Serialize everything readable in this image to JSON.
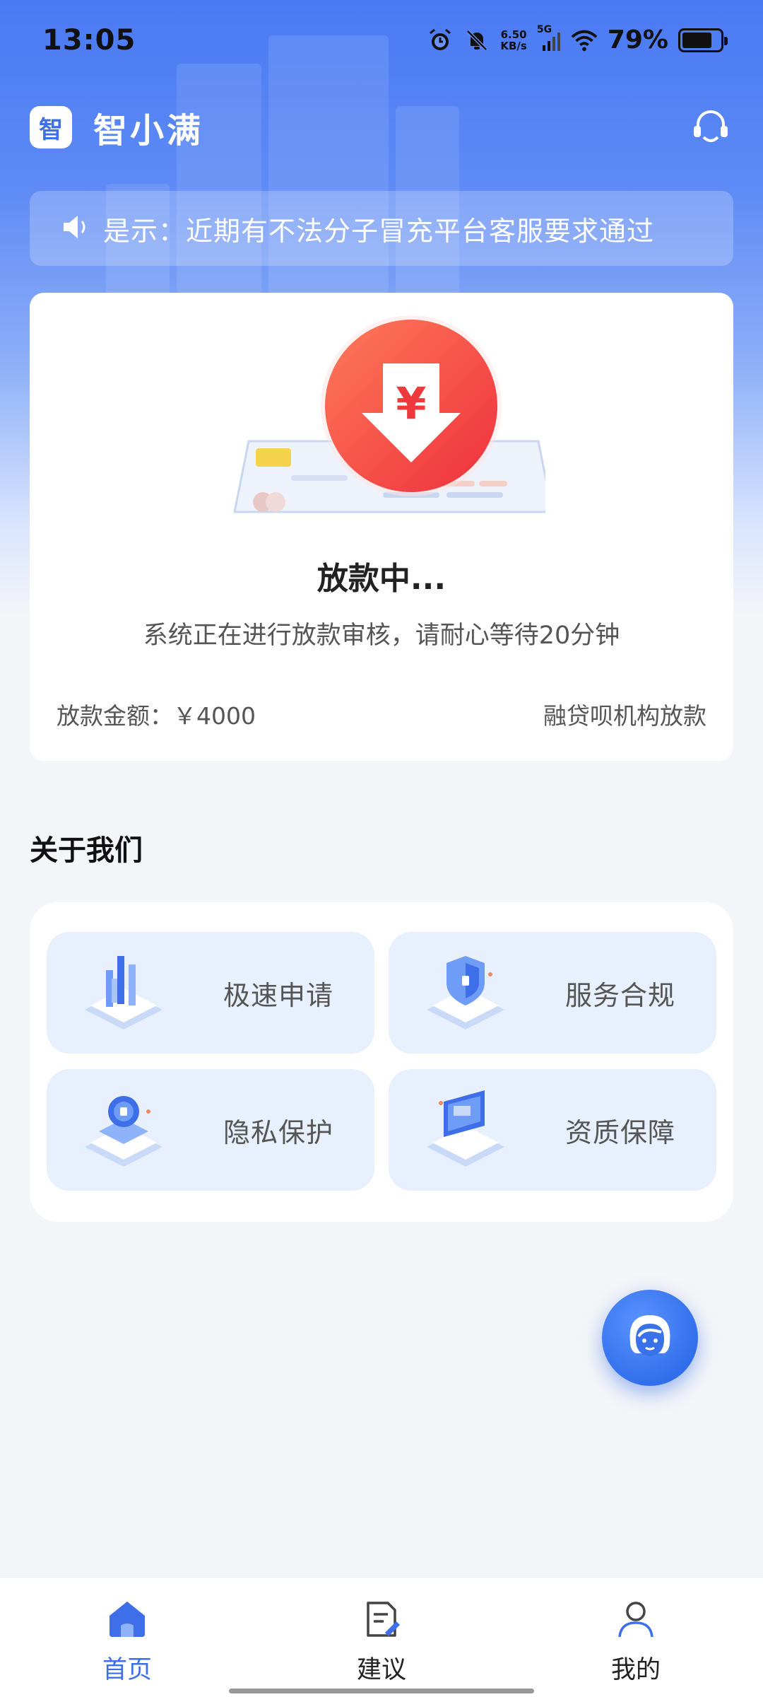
{
  "status_bar": {
    "time": "13:05",
    "net_speed_value": "6.50",
    "net_speed_unit": "KB/s",
    "signal": "5G",
    "battery": "79%",
    "battery_level": 0.79
  },
  "header": {
    "logo_text": "智",
    "title": "智小满",
    "service_icon": "headset-icon"
  },
  "notice": {
    "icon": "speaker-icon",
    "text": "是示：近期有不法分子冒充平台客服要求通过"
  },
  "loan_status": {
    "title": "放款中...",
    "description": "系统正在进行放款审核，请耐心等待20分钟",
    "amount_label": "放款金额：",
    "amount_value": "￥4000",
    "institution": "融贷呗机构放款"
  },
  "about": {
    "title": "关于我们",
    "features": [
      {
        "label": "极速申请",
        "icon": "fast-apply-icon"
      },
      {
        "label": "服务合规",
        "icon": "compliance-shield-icon"
      },
      {
        "label": "隐私保护",
        "icon": "privacy-lock-icon"
      },
      {
        "label": "资质保障",
        "icon": "qualification-card-icon"
      }
    ]
  },
  "fab": {
    "icon": "customer-service-avatar-icon"
  },
  "tabs": [
    {
      "label": "首页",
      "icon": "home-icon",
      "active": true
    },
    {
      "label": "建议",
      "icon": "suggestion-icon",
      "active": false
    },
    {
      "label": "我的",
      "icon": "profile-icon",
      "active": false
    }
  ],
  "colors": {
    "primary": "#3f6fe8",
    "accent_red": "#f2463e",
    "page_bg": "#f4f5f8",
    "feature_bg": "#e8f0fd"
  }
}
